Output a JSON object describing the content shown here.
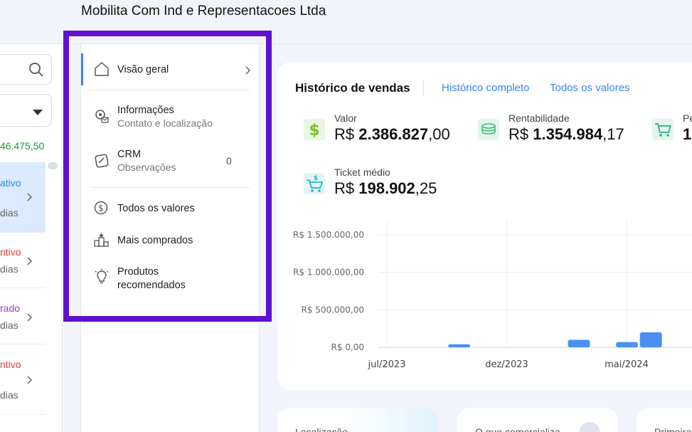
{
  "header": {
    "company": "Mobilita Com Ind e Representacoes Ltda"
  },
  "left_list": {
    "total": "46.475,50",
    "clients": [
      {
        "status": "ativo",
        "days": "dias",
        "color": "#2a8fd6"
      },
      {
        "status": "ntivo",
        "days": "dias",
        "color": "#e53935"
      },
      {
        "status": "rado",
        "days": "dias",
        "color": "#8e44ad"
      },
      {
        "status": "ntivo",
        "days": "dias",
        "color": "#e53935"
      }
    ]
  },
  "menu": {
    "overview": "Visão geral",
    "info_title": "Informações",
    "info_sub": "Contato e localização",
    "crm_title": "CRM",
    "crm_sub": "Observações",
    "crm_count": "0",
    "all_values": "Todos os valores",
    "top_bought": "Mais comprados",
    "recommended_1": "Produtos",
    "recommended_2": "recomendados"
  },
  "sales": {
    "title": "Histórico de vendas",
    "link_full": "Histórico completo",
    "link_all": "Todos os valores",
    "metrics": {
      "valor_label": "Valor",
      "valor_prefix": "R$ ",
      "valor_int": "2.386.827",
      "valor_dec": ",00",
      "rent_label": "Rentabilidade",
      "rent_prefix": "R$ ",
      "rent_int": "1.354.984",
      "rent_dec": ",17",
      "ped_label": "Pe",
      "ped_val": "1",
      "ticket_label": "Ticket médio",
      "ticket_prefix": "R$ ",
      "ticket_int": "198.902",
      "ticket_dec": ",25"
    }
  },
  "bottom": {
    "card1": "Localização",
    "card2": "O que comercializa",
    "card3": "Primeira"
  },
  "chart_data": {
    "type": "bar",
    "title": "",
    "xlabel": "",
    "ylabel": "",
    "y_ticks": [
      "R$ 1.500.000,00",
      "R$ 1.000.000,00",
      "R$ 500.000,00",
      "R$ 0,00"
    ],
    "y_tick_values": [
      1500000,
      1000000,
      500000,
      0
    ],
    "x_ticks": [
      "jul/2023",
      "dez/2023",
      "mai/2024"
    ],
    "ylim": [
      0,
      1500000
    ],
    "bars": [
      {
        "x_month": 3,
        "value": 40000
      },
      {
        "x_month": 8,
        "value": 100000
      },
      {
        "x_month": 10,
        "value": 70000
      },
      {
        "x_month": 11,
        "value": 200000
      }
    ],
    "grid": true,
    "color": "#4a90f0"
  }
}
